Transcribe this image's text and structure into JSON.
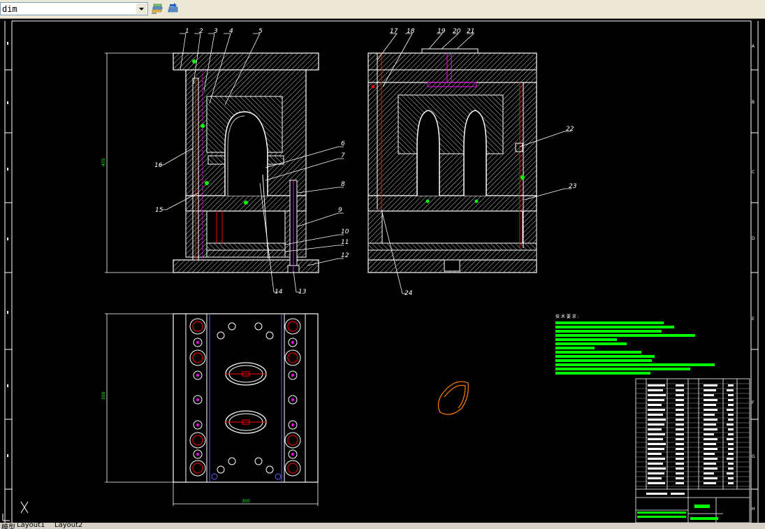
{
  "toolbar": {
    "layer_value": "dim",
    "layer_properties_icon": "layer-properties-icon",
    "layer_previous_icon": "layer-previous-icon"
  },
  "drawing": {
    "balloons_section_a": [
      "1",
      "2",
      "3",
      "4",
      "5",
      "6",
      "7",
      "8",
      "9",
      "10",
      "11",
      "12",
      "13",
      "14",
      "15",
      "16"
    ],
    "balloons_section_b": [
      "17",
      "18",
      "19",
      "20",
      "21",
      "22",
      "23",
      "24"
    ],
    "dim_height": "455",
    "dim_plan_height": "350",
    "dim_plan_width": "300",
    "tech_req_title": "技 术 要 求 :",
    "border_letters": [
      "A",
      "B",
      "C",
      "D",
      "E",
      "F",
      "G",
      "H"
    ],
    "ucs_label": "X"
  },
  "tabs": {
    "model_label": "模型",
    "layout1_label": "Layout1",
    "layout2_label": "Layout2"
  },
  "colors": {
    "background": "#000000",
    "line_white": "#ffffff",
    "hatch": "#d0d0d0",
    "green": "#00ff00",
    "red": "#ff0000",
    "magenta": "#ff00ff",
    "orange": "#ff8000",
    "blue": "#6060ff"
  }
}
